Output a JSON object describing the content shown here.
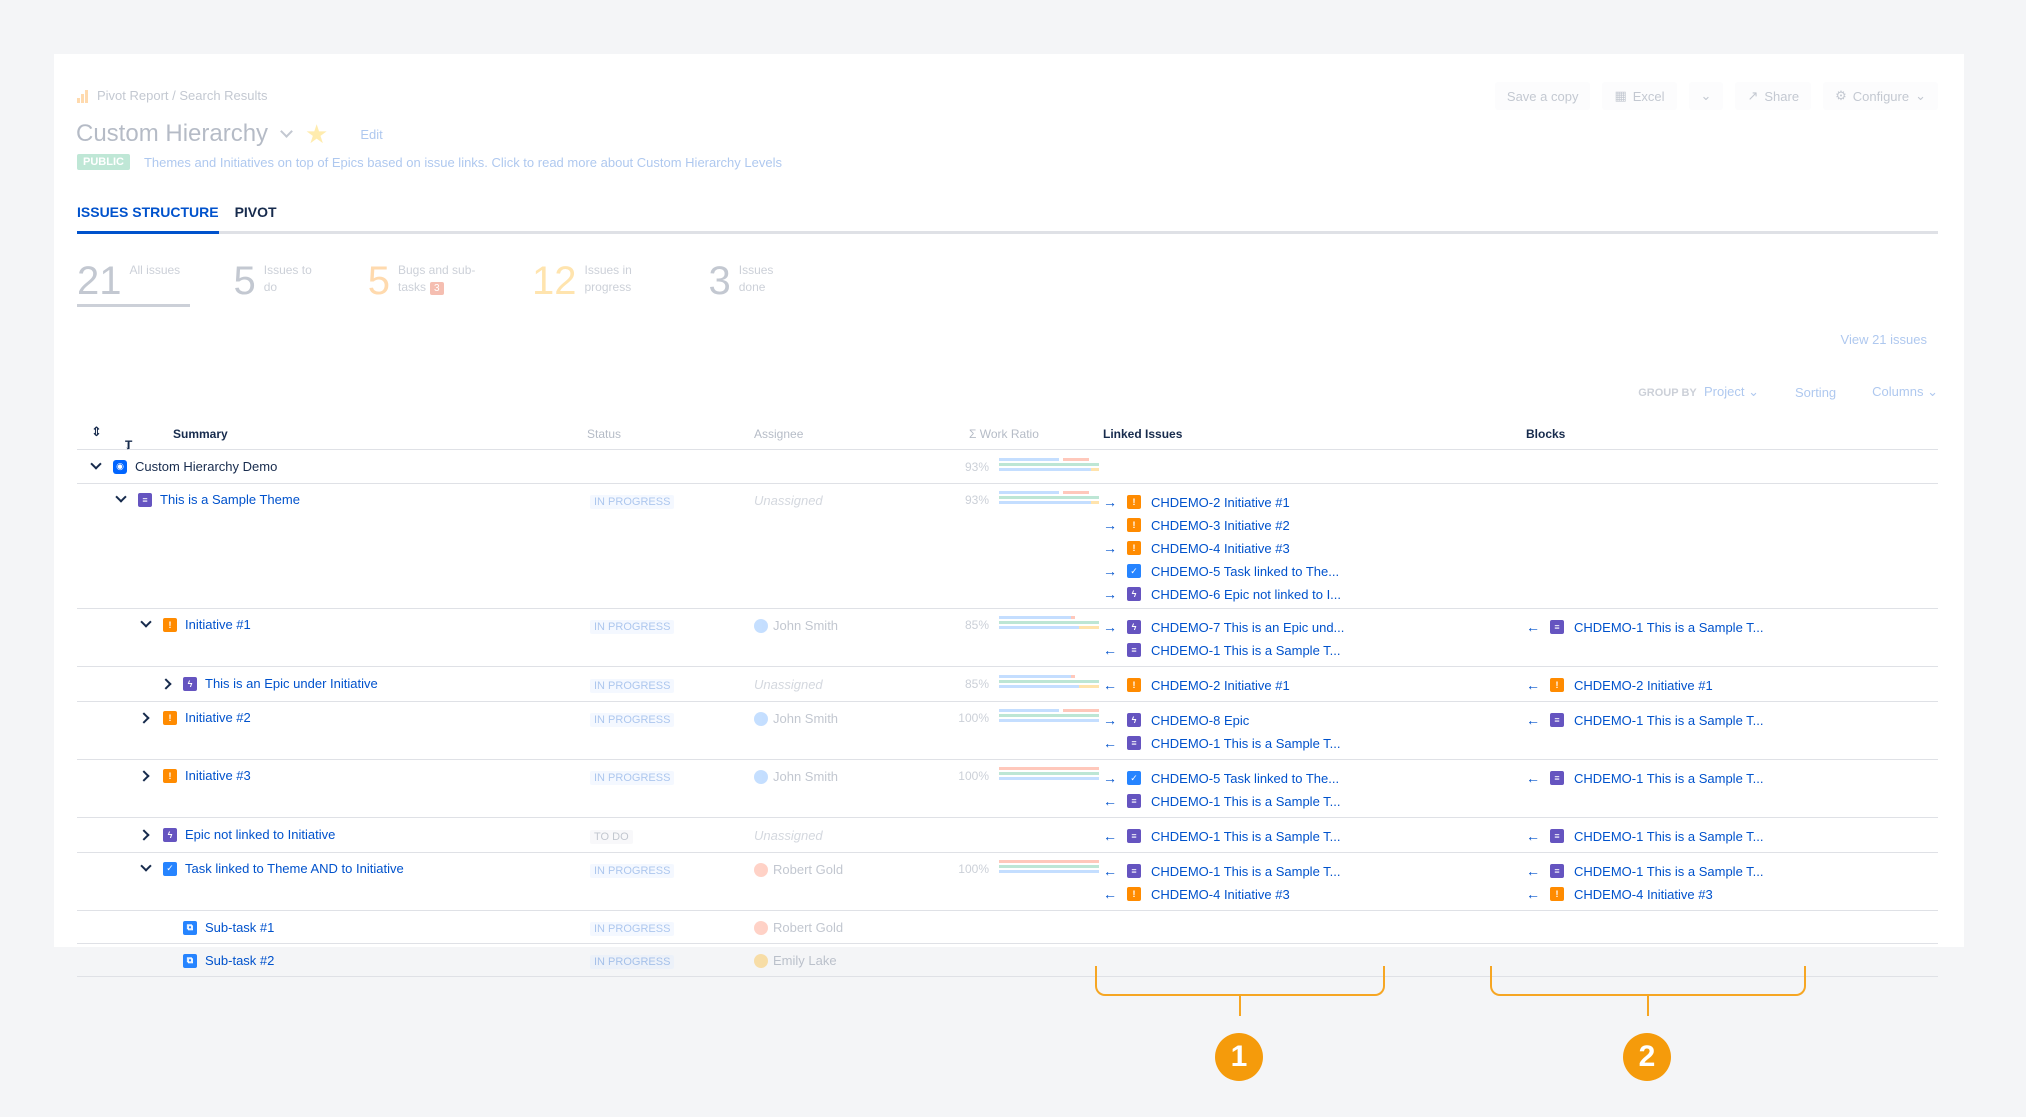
{
  "breadcrumb": "Pivot Report / Search Results",
  "page": {
    "title": "Custom Hierarchy",
    "edit": "Edit",
    "public_badge": "PUBLIC",
    "description": "Themes and Initiatives on top of Epics based on issue links. Click to read more about Custom Hierarchy Levels"
  },
  "actions": {
    "save_copy": "Save a copy",
    "excel": "Excel",
    "share": "Share",
    "configure": "Configure"
  },
  "tabs": [
    {
      "label": "ISSUES STRUCTURE"
    },
    {
      "label": "PIVOT"
    }
  ],
  "stats": [
    {
      "n": "21",
      "label": "All issues"
    },
    {
      "n": "5",
      "label": "Issues to do"
    },
    {
      "n": "5",
      "label": "Bugs and sub-tasks",
      "badge": "3"
    },
    {
      "n": "12",
      "label": "Issues in progress"
    },
    {
      "n": "3",
      "label": "Issues done"
    }
  ],
  "view_all": "View 21 issues",
  "toolbar": {
    "group_by_label": "GROUP BY",
    "group_by_value": "Project",
    "sorting": "Sorting",
    "columns": "Columns"
  },
  "headers": {
    "t": "T",
    "summary": "Summary",
    "status": "Status",
    "assignee": "Assignee",
    "work_ratio": "Σ Work Ratio",
    "linked": "Linked Issues",
    "blocks": "Blocks"
  },
  "rows": [
    {
      "summary": "Custom Hierarchy Demo",
      "pct": "93%"
    },
    {
      "summary": "This is a Sample Theme",
      "status": "IN PROGRESS",
      "assignee": "Unassigned",
      "pct": "93%",
      "linked": [
        "CHDEMO-2 Initiative #1",
        "CHDEMO-3 Initiative #2",
        "CHDEMO-4 Initiative #3",
        "CHDEMO-5 Task linked to The...",
        "CHDEMO-6 Epic not linked to I..."
      ]
    },
    {
      "summary": "Initiative #1",
      "status": "IN PROGRESS",
      "assignee": "John Smith",
      "pct": "85%",
      "linked": [
        "CHDEMO-7 This is an Epic und...",
        "CHDEMO-1 This is a Sample T..."
      ],
      "blocks": [
        "CHDEMO-1 This is a Sample T..."
      ]
    },
    {
      "summary": "This is an Epic under Initiative",
      "status": "IN PROGRESS",
      "assignee": "Unassigned",
      "pct": "85%",
      "linked": [
        "CHDEMO-2 Initiative #1"
      ],
      "blocks": [
        "CHDEMO-2 Initiative #1"
      ]
    },
    {
      "summary": "Initiative #2",
      "status": "IN PROGRESS",
      "assignee": "John Smith",
      "pct": "100%",
      "linked": [
        "CHDEMO-8 Epic",
        "CHDEMO-1 This is a Sample T..."
      ],
      "blocks": [
        "CHDEMO-1 This is a Sample T..."
      ]
    },
    {
      "summary": "Initiative #3",
      "status": "IN PROGRESS",
      "assignee": "John Smith",
      "pct": "100%",
      "linked": [
        "CHDEMO-5 Task linked to The...",
        "CHDEMO-1 This is a Sample T..."
      ],
      "blocks": [
        "CHDEMO-1 This is a Sample T..."
      ]
    },
    {
      "summary": "Epic not linked to Initiative",
      "status": "TO DO",
      "assignee": "Unassigned",
      "linked": [
        "CHDEMO-1 This is a Sample T..."
      ],
      "blocks": [
        "CHDEMO-1 This is a Sample T..."
      ]
    },
    {
      "summary": "Task linked to Theme AND to Initiative",
      "status": "IN PROGRESS",
      "assignee": "Robert Gold",
      "pct": "100%",
      "linked": [
        "CHDEMO-1 This is a Sample T...",
        "CHDEMO-4 Initiative #3"
      ],
      "blocks": [
        "CHDEMO-1 This is a Sample T...",
        "CHDEMO-4 Initiative #3"
      ]
    },
    {
      "summary": "Sub-task #1",
      "status": "IN PROGRESS",
      "assignee": "Robert Gold"
    },
    {
      "summary": "Sub-task #2",
      "status": "IN PROGRESS",
      "assignee": "Emily Lake"
    }
  ],
  "callouts": [
    "1",
    "2"
  ]
}
